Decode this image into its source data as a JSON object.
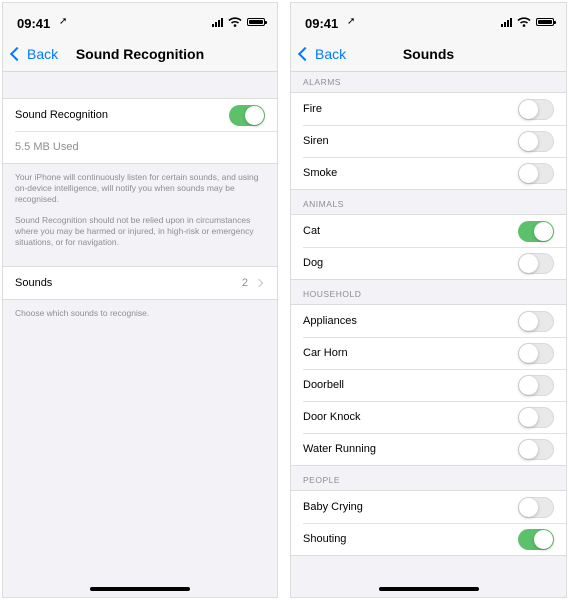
{
  "left": {
    "status": {
      "time": "09:41",
      "location_glyph": "➚"
    },
    "nav": {
      "back_label": "Back",
      "title": "Sound Recognition"
    },
    "main": {
      "toggle_label": "Sound Recognition",
      "toggle_on": true,
      "storage_used": "5.5 MB Used",
      "footer_1": "Your iPhone will continuously listen for certain sounds, and using on-device intelligence, will notify you when sounds may be recognised.",
      "footer_2": "Sound Recognition should not be relied upon in circumstances where you may be harmed or injured, in high-risk or emergency situations, or for navigation."
    },
    "sounds": {
      "label": "Sounds",
      "count": "2",
      "footer": "Choose which sounds to recognise."
    }
  },
  "right": {
    "status": {
      "time": "09:41",
      "location_glyph": "➚"
    },
    "nav": {
      "back_label": "Back",
      "title": "Sounds"
    },
    "sections": [
      {
        "header": "ALARMS",
        "items": [
          {
            "label": "Fire",
            "on": false
          },
          {
            "label": "Siren",
            "on": false
          },
          {
            "label": "Smoke",
            "on": false
          }
        ]
      },
      {
        "header": "ANIMALS",
        "items": [
          {
            "label": "Cat",
            "on": true
          },
          {
            "label": "Dog",
            "on": false
          }
        ]
      },
      {
        "header": "HOUSEHOLD",
        "items": [
          {
            "label": "Appliances",
            "on": false
          },
          {
            "label": "Car Horn",
            "on": false
          },
          {
            "label": "Doorbell",
            "on": false
          },
          {
            "label": "Door Knock",
            "on": false
          },
          {
            "label": "Water Running",
            "on": false
          }
        ]
      },
      {
        "header": "PEOPLE",
        "items": [
          {
            "label": "Baby Crying",
            "on": false
          },
          {
            "label": "Shouting",
            "on": true
          }
        ]
      }
    ]
  },
  "colors": {
    "accent": "#007aff",
    "toggle_on": "#5cc16a",
    "toggle_off": "#e9e9ea",
    "background": "#f2f2f7"
  },
  "icons": [
    "location-arrow-icon",
    "cellular-signal-icon",
    "wifi-icon",
    "battery-icon",
    "chevron-left-icon",
    "chevron-right-icon"
  ]
}
